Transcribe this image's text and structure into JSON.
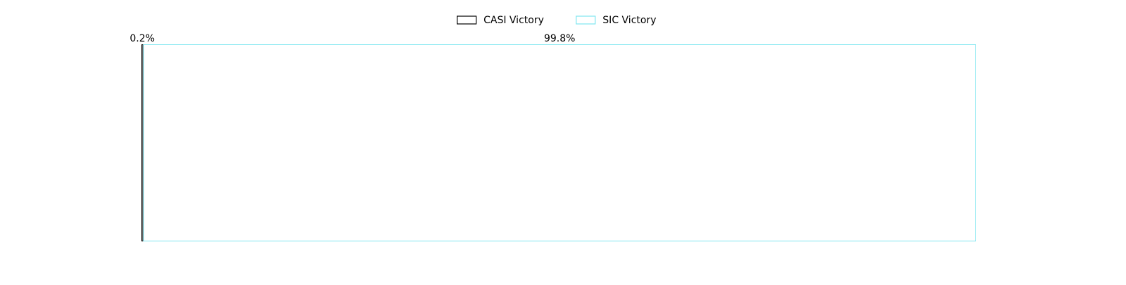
{
  "chart_data": {
    "type": "bar",
    "orientation": "horizontal-stacked",
    "legend_position": "top-center",
    "grid": false,
    "axes_visible": false,
    "xlim": [
      0,
      100
    ],
    "series": [
      {
        "name": "CASI Victory",
        "value": 0.2,
        "label": "0.2%",
        "edge_color": "#000000",
        "fill": "#ffffff"
      },
      {
        "name": "SIC Victory",
        "value": 99.8,
        "label": "99.8%",
        "edge_color": "#7fe6f0",
        "fill": "#ffffff"
      }
    ]
  }
}
